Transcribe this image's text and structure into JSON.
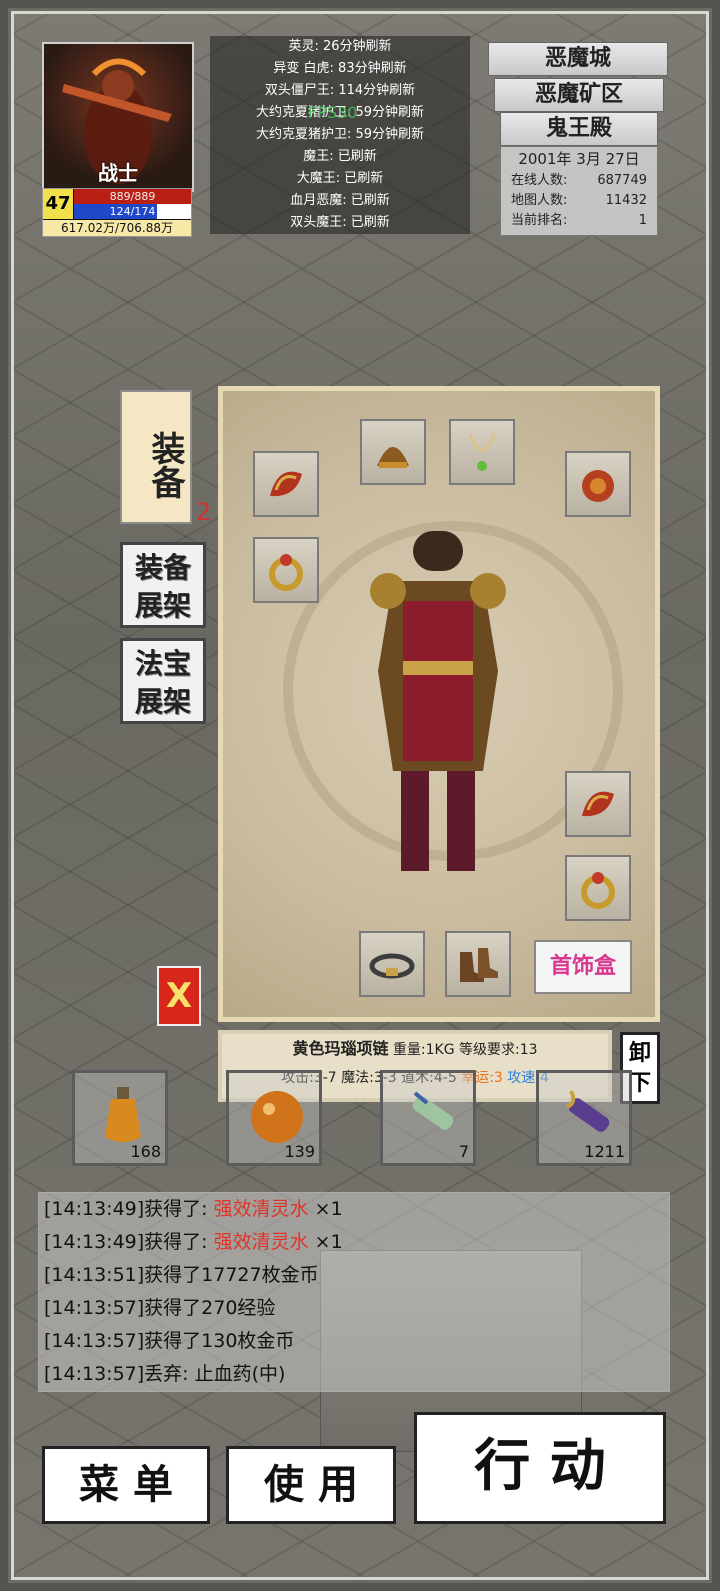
{
  "player": {
    "class_label": "战士",
    "level": "47",
    "hp": "889/889",
    "mp": "124/174",
    "mp_fraction": 0.71,
    "gold": "617.02万/706.88万"
  },
  "boss_timers": [
    "英灵: 26分钟刷新",
    "异变 白虎: 83分钟刷新",
    "双头僵尸王: 114分钟刷新",
    "大约克夏猪护卫: 59分钟刷新",
    "大约克夏猪护卫: 59分钟刷新",
    "魔王: 已刷新",
    "大魔王: 已刷新",
    "血月恶魔: 已刷新",
    "双头魔王: 已刷新"
  ],
  "fps": "FPS30",
  "location": {
    "city": "恶魔城",
    "area": "恶魔矿区",
    "map": "鬼王殿",
    "date": "2001年 3月 27日",
    "online_label": "在线人数:",
    "online_value": "687749",
    "map_label": "地图人数:",
    "map_value": "11432",
    "rank_label": "当前排名:",
    "rank_value": "1"
  },
  "tabs": {
    "equip": "装备",
    "equip_rack": "装备展架",
    "treasure_rack": "法宝展架",
    "badge": "2"
  },
  "equip_panel": {
    "jewel_box": "首饰盒",
    "close": "X",
    "unequip": "卸下"
  },
  "item_desc": {
    "name": "黄色玛瑙项链",
    "weight": "重量:1KG",
    "level_req": "等级要求:13",
    "attack": "攻击:3-7",
    "magic": "魔法:3-3",
    "taoism": "道术:4-5",
    "luck": "幸运:3",
    "speed": "攻速:4",
    "luck_color": "#e9711c",
    "speed_color": "#2d7fd6"
  },
  "quick_items": [
    {
      "name": "potion-icon",
      "count": "168"
    },
    {
      "name": "orb-potion-icon",
      "count": "139"
    },
    {
      "name": "scroll-icon",
      "count": "7"
    },
    {
      "name": "purple-scroll-icon",
      "count": "1211"
    }
  ],
  "log": [
    {
      "prefix": "[14:13:49]获得了: ",
      "item": "强效清灵水",
      "suffix": " ×1"
    },
    {
      "prefix": "[14:13:49]获得了: ",
      "item": "强效清灵水",
      "suffix": " ×1"
    },
    {
      "prefix": "[14:13:51]获得了17727枚金币",
      "item": "",
      "suffix": ""
    },
    {
      "prefix": "[14:13:57]获得了270经验",
      "item": "",
      "suffix": ""
    },
    {
      "prefix": "[14:13:57]获得了130枚金币",
      "item": "",
      "suffix": ""
    },
    {
      "prefix": "[14:13:57]丢弃: 止血药(中)",
      "item": "",
      "suffix": ""
    }
  ],
  "buttons": {
    "menu": "菜 单",
    "use": "使 用",
    "action": "行 动"
  }
}
